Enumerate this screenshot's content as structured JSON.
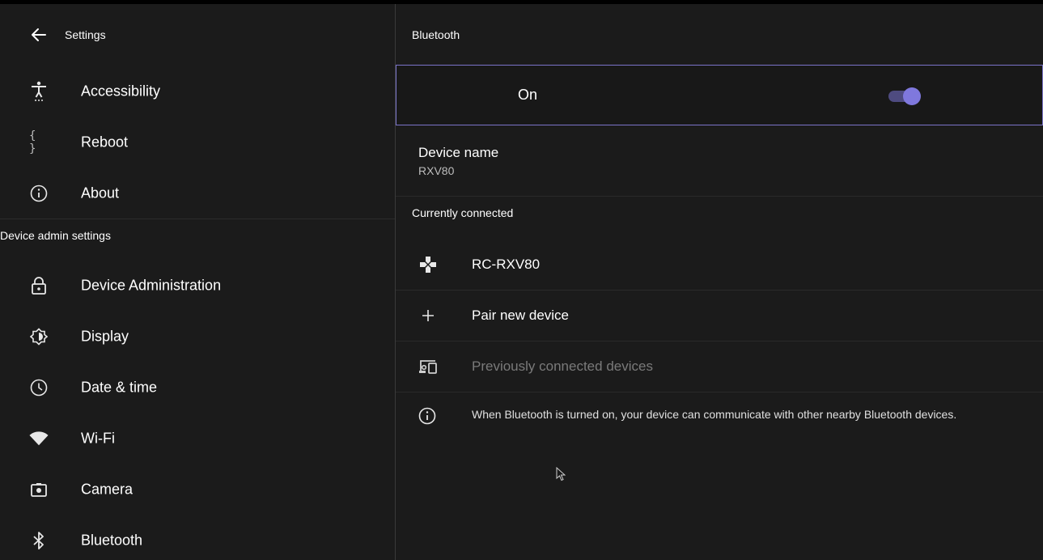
{
  "sidebar": {
    "title": "Settings",
    "items_top": [
      {
        "label": "Accessibility",
        "icon": "accessibility-icon"
      },
      {
        "label": "Reboot",
        "icon": "braces-icon"
      },
      {
        "label": "About",
        "icon": "info-icon"
      }
    ],
    "section_header": "Device admin settings",
    "items_admin": [
      {
        "label": "Device Administration",
        "icon": "lock-icon"
      },
      {
        "label": "Display",
        "icon": "brightness-icon"
      },
      {
        "label": "Date & time",
        "icon": "clock-icon"
      },
      {
        "label": "Wi-Fi",
        "icon": "wifi-icon"
      },
      {
        "label": "Camera",
        "icon": "camera-icon"
      },
      {
        "label": "Bluetooth",
        "icon": "bluetooth-icon"
      }
    ]
  },
  "main": {
    "title": "Bluetooth",
    "toggle": {
      "label": "On",
      "state": "on"
    },
    "device_name": {
      "title": "Device name",
      "value": "RXV80"
    },
    "currently_connected_header": "Currently connected",
    "connected_device": {
      "label": "RC-RXV80",
      "icon": "gamepad-icon"
    },
    "pair_new": {
      "label": "Pair new device",
      "icon": "plus-icon"
    },
    "previously": {
      "label": "Previously connected devices",
      "icon": "devices-icon"
    },
    "info_text": "When Bluetooth is turned on, your device can communicate with other nearby Bluetooth devices."
  },
  "colors": {
    "background": "#1b1b1b",
    "accent": "#7f78dd",
    "accent_track": "#4e4b80",
    "focus_border": "#7b74c9",
    "dim_text": "#7a7a7a"
  }
}
